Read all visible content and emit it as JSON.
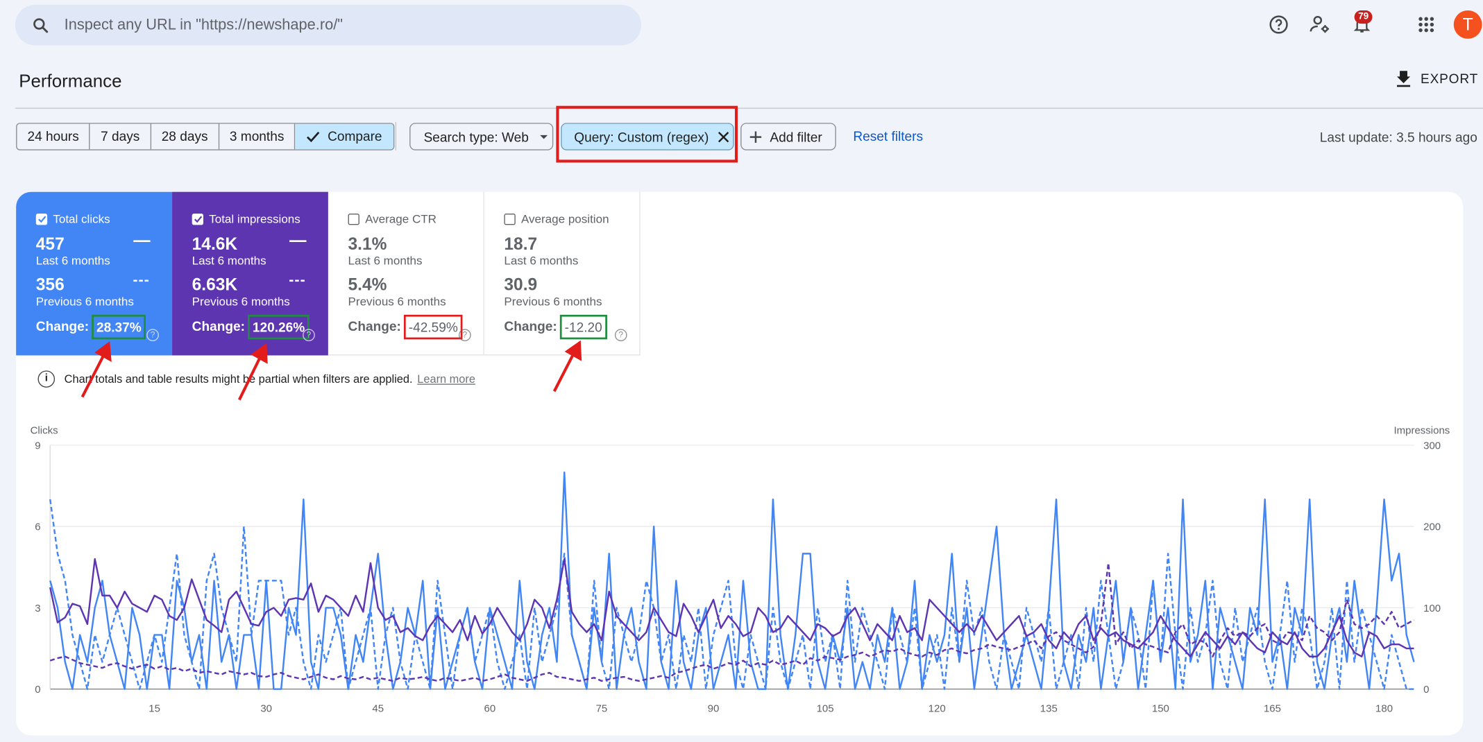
{
  "search": {
    "placeholder": "Inspect any URL in \"https://newshape.ro/\""
  },
  "notifications": {
    "count": "79"
  },
  "user": {
    "avatar_letter": "T"
  },
  "icons": [
    "search-icon",
    "help-icon",
    "manage-users-icon",
    "bell-icon",
    "apps-grid-icon",
    "download-icon",
    "check-icon",
    "dropdown-caret-icon",
    "close-icon",
    "plus-icon",
    "info-icon"
  ],
  "header": {
    "title": "Performance",
    "export_label": "EXPORT"
  },
  "filters": {
    "ranges": [
      "24 hours",
      "7 days",
      "28 days",
      "3 months"
    ],
    "compare_label": "Compare",
    "search_type": "Search type: Web",
    "query": "Query: Custom (regex)",
    "add_filter": "Add filter",
    "reset": "Reset filters",
    "last_update": "Last update: 3.5 hours ago"
  },
  "metrics": {
    "clicks": {
      "label": "Total clicks",
      "current": "457",
      "current_label": "Last 6 months",
      "previous": "356",
      "previous_label": "Previous 6 months",
      "change_label": "Change:",
      "change": "28.37%",
      "checked": true
    },
    "impressions": {
      "label": "Total impressions",
      "current": "14.6K",
      "current_label": "Last 6 months",
      "previous": "6.63K",
      "previous_label": "Previous 6 months",
      "change_label": "Change:",
      "change": "120.26%",
      "checked": true
    },
    "ctr": {
      "label": "Average CTR",
      "current": "3.1%",
      "current_label": "Last 6 months",
      "previous": "5.4%",
      "previous_label": "Previous 6 months",
      "change_label": "Change:",
      "change": "-42.59%",
      "checked": false
    },
    "position": {
      "label": "Average position",
      "current": "18.7",
      "current_label": "Last 6 months",
      "previous": "30.9",
      "previous_label": "Previous 6 months",
      "change_label": "Change:",
      "change": "-12.20",
      "checked": false
    }
  },
  "notice": {
    "text": "Chart totals and table results might be partial when filters are applied.",
    "link": "Learn more"
  },
  "colors": {
    "clicks": "#4285f4",
    "impressions": "#5e35b1",
    "highlight_green": "#1e8e3e",
    "highlight_red": "#e21b1b"
  },
  "chart_data": {
    "type": "line",
    "ylabel_left": "Clicks",
    "ylabel_right": "Impressions",
    "ylim_left": [
      0,
      9
    ],
    "ylim_right": [
      0,
      300
    ],
    "yticks_left": [
      "0",
      "3",
      "6",
      "9"
    ],
    "yticks_right": [
      "0",
      "100",
      "200",
      "300"
    ],
    "xticks": [
      "15",
      "30",
      "45",
      "60",
      "75",
      "90",
      "105",
      "120",
      "135",
      "150",
      "165",
      "180"
    ],
    "xlim": [
      1,
      184
    ],
    "series": [
      {
        "name": "Clicks (last 6 months)",
        "axis": "left",
        "style": "solid",
        "color": "#4285f4",
        "values": [
          4,
          3,
          1,
          0,
          2,
          1,
          3,
          4,
          2,
          1,
          0,
          3,
          2,
          0,
          2,
          2,
          0,
          4,
          3,
          1,
          2,
          0,
          4,
          1,
          2,
          0,
          2,
          2,
          0,
          4,
          0,
          0,
          3,
          2,
          7,
          1,
          0,
          3,
          3,
          2,
          0,
          2,
          1,
          3,
          5,
          2,
          0,
          1,
          3,
          2,
          4,
          0,
          3,
          0,
          1,
          2,
          3,
          1,
          0,
          3,
          2,
          1,
          0,
          4,
          1,
          0,
          2,
          3,
          1,
          8,
          2,
          1,
          0,
          3,
          1,
          5,
          0,
          2,
          3,
          1,
          0,
          6,
          1,
          0,
          4,
          1,
          0,
          2,
          3,
          0,
          1,
          2,
          0,
          4,
          1,
          0,
          0,
          7,
          2,
          0,
          2,
          5,
          5,
          1,
          0,
          2,
          1,
          3,
          0,
          1,
          0,
          2,
          1,
          3,
          0,
          1,
          4,
          0,
          2,
          1,
          2,
          5,
          1,
          3,
          0,
          2,
          4,
          6,
          2,
          0,
          1,
          2,
          1,
          0,
          3,
          7,
          1,
          0,
          2,
          1,
          3,
          0,
          2,
          4,
          1,
          3,
          0,
          2,
          4,
          1,
          3,
          0,
          7,
          1,
          2,
          4,
          0,
          3,
          2,
          1,
          0,
          3,
          2,
          7,
          1,
          2,
          0,
          3,
          2,
          7,
          1,
          0,
          2,
          3,
          1,
          4,
          2,
          0,
          3,
          7,
          4,
          5,
          2,
          1
        ]
      },
      {
        "name": "Clicks (previous 6 months)",
        "axis": "left",
        "style": "dashed",
        "color": "#4285f4",
        "values": [
          7,
          5,
          4,
          2,
          1,
          0,
          2,
          1,
          2,
          3,
          2,
          1,
          0,
          1,
          2,
          1,
          3,
          5,
          2,
          1,
          0,
          4,
          5,
          3,
          2,
          1,
          6,
          2,
          4,
          4,
          4,
          4,
          2,
          3,
          1,
          0,
          2,
          1,
          2,
          3,
          0,
          1,
          2,
          3,
          0,
          2,
          3,
          1,
          0,
          2,
          1,
          0,
          4,
          2,
          0,
          2,
          3,
          1,
          2,
          3,
          1,
          0,
          1,
          2,
          0,
          3,
          1,
          2,
          3,
          5,
          2,
          1,
          0,
          4,
          1,
          0,
          3,
          2,
          1,
          2,
          4,
          3,
          1,
          2,
          0,
          2,
          1,
          3,
          0,
          2,
          3,
          4,
          1,
          0,
          2,
          1,
          0,
          3,
          1,
          0,
          1,
          2,
          0,
          3,
          1,
          2,
          0,
          4,
          1,
          3,
          2,
          1,
          0,
          3,
          2,
          1,
          3,
          0,
          1,
          2,
          0,
          3,
          1,
          4,
          2,
          3,
          1,
          0,
          2,
          1,
          0,
          3,
          2,
          1,
          3,
          0,
          1,
          2,
          0,
          3,
          1,
          4,
          2,
          0,
          1,
          3,
          2,
          0,
          4,
          1,
          5,
          2,
          0,
          3,
          1,
          2,
          4,
          1,
          0,
          3,
          1,
          2,
          3,
          1,
          0,
          2,
          4,
          1,
          3,
          2,
          0,
          1,
          3,
          0,
          4,
          1,
          3,
          2,
          1,
          0,
          2,
          1,
          0,
          0
        ]
      },
      {
        "name": "Impressions (last 6 months)",
        "axis": "right",
        "style": "solid",
        "color": "#5e35b1",
        "values": [
          125,
          82,
          88,
          105,
          102,
          80,
          160,
          115,
          115,
          100,
          120,
          105,
          100,
          95,
          115,
          110,
          90,
          85,
          100,
          135,
          110,
          85,
          78,
          70,
          110,
          120,
          100,
          80,
          78,
          95,
          100,
          90,
          110,
          112,
          110,
          130,
          95,
          115,
          110,
          100,
          90,
          115,
          95,
          155,
          100,
          85,
          90,
          70,
          75,
          65,
          60,
          78,
          90,
          80,
          70,
          85,
          60,
          90,
          68,
          80,
          100,
          85,
          70,
          60,
          80,
          110,
          100,
          75,
          110,
          160,
          95,
          80,
          70,
          80,
          60,
          120,
          90,
          80,
          70,
          60,
          70,
          100,
          85,
          70,
          65,
          105,
          90,
          70,
          90,
          110,
          75,
          90,
          80,
          65,
          70,
          100,
          90,
          70,
          75,
          90,
          80,
          70,
          60,
          80,
          75,
          65,
          70,
          90,
          100,
          80,
          60,
          80,
          70,
          60,
          90,
          70,
          75,
          60,
          110,
          100,
          90,
          80,
          70,
          80,
          70,
          90,
          75,
          60,
          70,
          80,
          90,
          65,
          70,
          80,
          60,
          50,
          70,
          60,
          80,
          90,
          60,
          75,
          65,
          70,
          60,
          55,
          50,
          60,
          70,
          90,
          75,
          60,
          50,
          40,
          55,
          70,
          60,
          50,
          65,
          55,
          70,
          60,
          50,
          45,
          70,
          60,
          55,
          70,
          50,
          40,
          40,
          50,
          70,
          90,
          60,
          45,
          40,
          70,
          65,
          50,
          55,
          55,
          50,
          50
        ]
      },
      {
        "name": "Impressions (previous 6 months)",
        "axis": "right",
        "style": "dashed",
        "color": "#5e35b1",
        "values": [
          35,
          38,
          40,
          36,
          32,
          30,
          28,
          26,
          30,
          32,
          28,
          25,
          28,
          30,
          25,
          28,
          24,
          26,
          22,
          25,
          20,
          22,
          20,
          18,
          22,
          20,
          18,
          20,
          16,
          15,
          18,
          20,
          16,
          14,
          12,
          15,
          18,
          14,
          12,
          16,
          13,
          12,
          15,
          12,
          14,
          12,
          10,
          14,
          12,
          13,
          15,
          12,
          10,
          14,
          12,
          10,
          12,
          14,
          10,
          12,
          15,
          18,
          14,
          12,
          10,
          14,
          18,
          20,
          15,
          14,
          12,
          10,
          12,
          14,
          10,
          12,
          14,
          15,
          12,
          10,
          12,
          14,
          16,
          14,
          20,
          22,
          25,
          28,
          30,
          25,
          28,
          32,
          30,
          35,
          28,
          32,
          30,
          35,
          30,
          32,
          35,
          30,
          38,
          35,
          40,
          38,
          36,
          40,
          42,
          45,
          40,
          44,
          48,
          46,
          50,
          45,
          42,
          40,
          45,
          42,
          48,
          50,
          46,
          44,
          48,
          50,
          55,
          52,
          50,
          48,
          52,
          55,
          60,
          50,
          65,
          70,
          60,
          55,
          50,
          45,
          52,
          80,
          155,
          55,
          70,
          50,
          60,
          55,
          52,
          48,
          45,
          70,
          80,
          55,
          60,
          58,
          40,
          60,
          75,
          65,
          70,
          65,
          75,
          80,
          60,
          55,
          70,
          68,
          60,
          90,
          75,
          70,
          60,
          70,
          110,
          80,
          75,
          80,
          90,
          80,
          95,
          75,
          80,
          85
        ]
      }
    ]
  }
}
